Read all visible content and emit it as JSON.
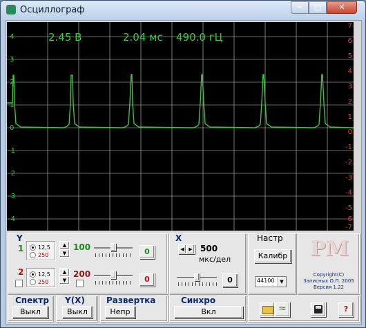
{
  "window": {
    "title": "Осциллограф",
    "min_glyph": "─",
    "max_glyph": "□",
    "close_glyph": "✕"
  },
  "scope": {
    "readout": {
      "voltage": "2.45 В",
      "period": "2.04 мс",
      "frequency": "490.0 гЦ"
    },
    "left_axis": [
      "4",
      "3",
      "2",
      "1",
      "0",
      "-1",
      "-2",
      "-3",
      "-4"
    ],
    "right_axis": [
      "7",
      "6",
      "5",
      "4",
      "3",
      "2",
      "1",
      "0",
      "-1",
      "-2",
      "-3",
      "-4",
      "-5",
      "-6",
      "-7"
    ],
    "trace_color": "#3ec63e",
    "left_axis_color": "#33cc33",
    "right_axis_color": "#ff3333"
  },
  "controls": {
    "y": {
      "label": "Y",
      "ch1": {
        "label": "1",
        "opt_a": "12,5",
        "opt_b": "250",
        "selected": "12,5",
        "value": "100",
        "button": "0",
        "slider": 0.5
      },
      "ch2": {
        "label": "2",
        "opt_a": "12,5",
        "opt_b": "250",
        "selected": "12,5",
        "value": "200",
        "button": "0",
        "slider": 0.5
      }
    },
    "x": {
      "label": "X",
      "value": "500",
      "unit": "мкс/дел",
      "button": "0",
      "slider": 0.5
    },
    "settings": {
      "label": "Настр",
      "calib_button": "Калибр",
      "rate": "44100"
    },
    "logo": {
      "text": "PM",
      "copyright": "Copyright(C)",
      "author": "Записных О.П. 2005",
      "version": "Версия 1.22"
    },
    "spectrum": {
      "label": "Спектр",
      "button": "Выкл"
    },
    "yx": {
      "label": "Y(X)",
      "button": "Выкл"
    },
    "sweep": {
      "label": "Развертка",
      "button": "Непр"
    },
    "sync": {
      "label": "Синхро",
      "button": "Вкл"
    },
    "help": "?"
  }
}
